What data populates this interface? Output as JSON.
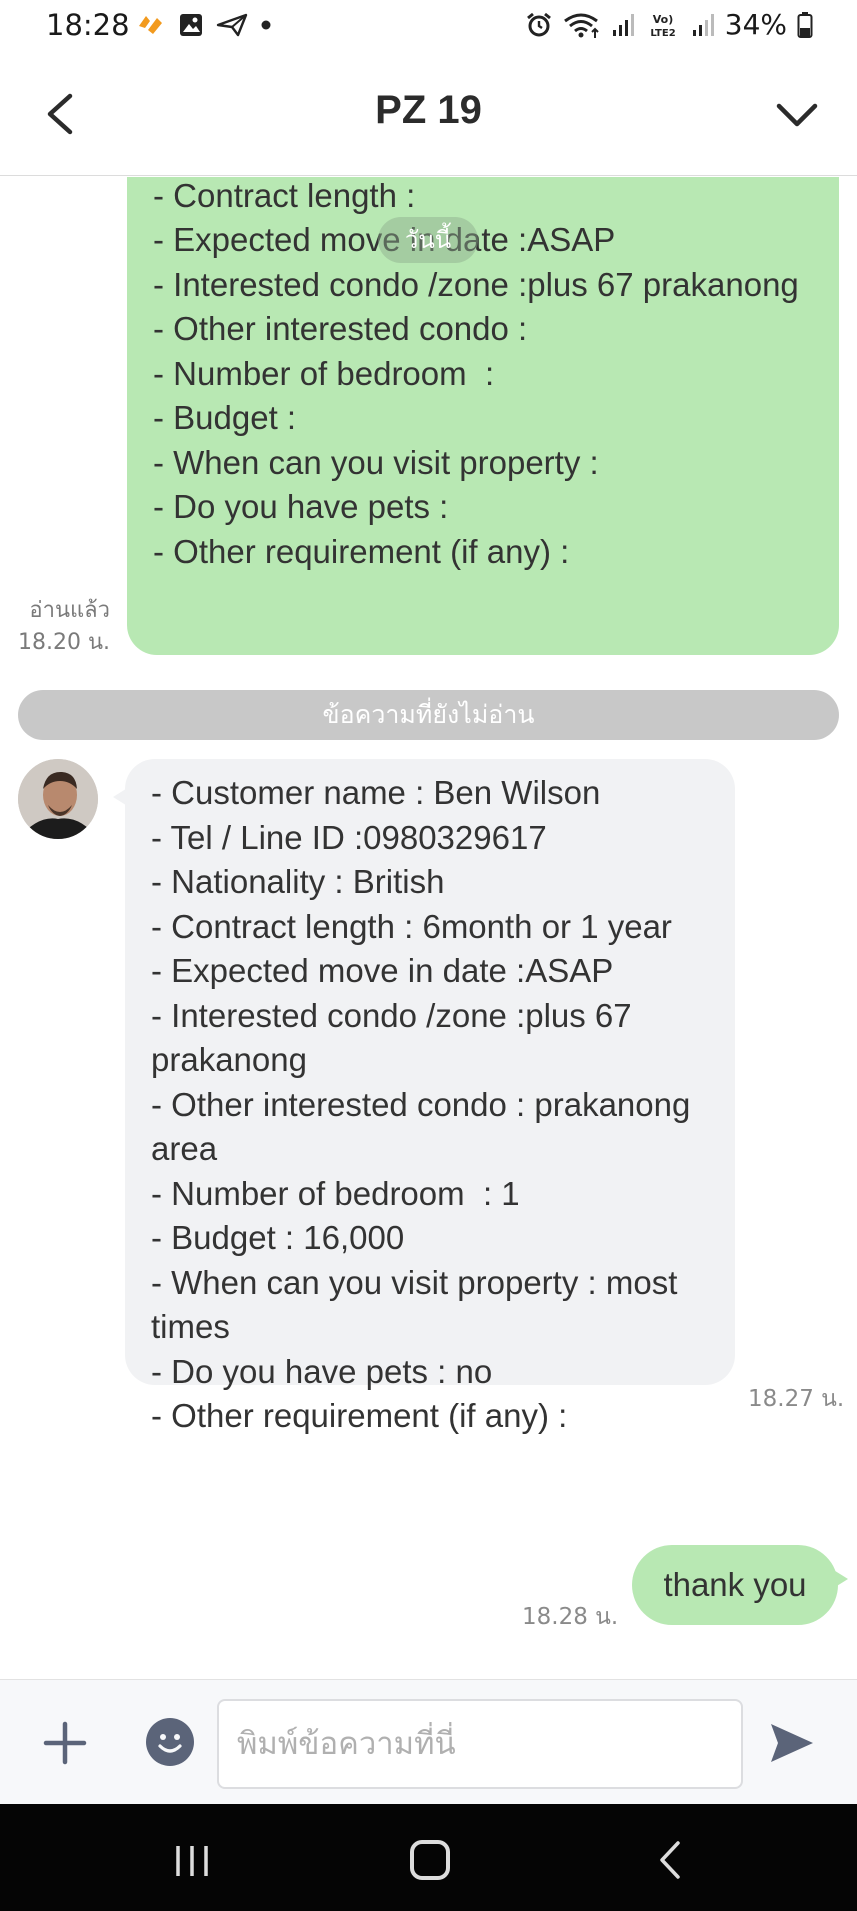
{
  "status_bar": {
    "time": "18:28",
    "battery": "34%",
    "left_icons": [
      "app-notification-icon",
      "gallery-icon",
      "send-icon",
      "dot-icon"
    ],
    "right_icons": [
      "alarm-icon",
      "wifi-icon",
      "signal-icon",
      "volte-icon",
      "signal-icon",
      "battery-icon"
    ],
    "volte_label": "Vo) LTE2"
  },
  "header": {
    "title": "PZ 19",
    "back_icon": "chevron-left-icon",
    "menu_icon": "chevron-down-icon"
  },
  "chat": {
    "date_chip": "วันนี้",
    "unread_divider": "ข้อความที่ยังไม่อ่าน",
    "messages": [
      {
        "direction": "outgoing",
        "text": "- Nationality :\n- Contract length :\n- Expected move in date :ASAP\n- Interested condo /zone :plus 67 prakanong\n- Other interested condo :\n- Number of bedroom  :\n- Budget :\n- When can you visit property :\n- Do you have pets :\n- Other requirement (if any) :",
        "read_status": "อ่านแล้ว",
        "time": "18.20 น."
      },
      {
        "direction": "incoming",
        "text": "- Customer name : Ben Wilson\n- Tel / Line ID :0980329617\n- Nationality : British\n- Contract length : 6month or 1 year\n- Expected move in date :ASAP\n- Interested condo /zone :plus 67 prakanong\n- Other interested condo : prakanong area\n- Number of bedroom  : 1\n- Budget : 16,000\n- When can you visit property : most times\n- Do you have pets : no\n- Other requirement (if any) :",
        "time": "18.27 น."
      },
      {
        "direction": "outgoing",
        "text": "thank you",
        "time": "18.28 น."
      }
    ]
  },
  "input_bar": {
    "placeholder": "พิมพ์ข้อความที่นี่",
    "value": ""
  },
  "colors": {
    "outgoing_bubble": "#b8e8b3",
    "incoming_bubble": "#f1f2f4",
    "divider": "#c8c8c8",
    "icon_dark": "#5b6479"
  }
}
